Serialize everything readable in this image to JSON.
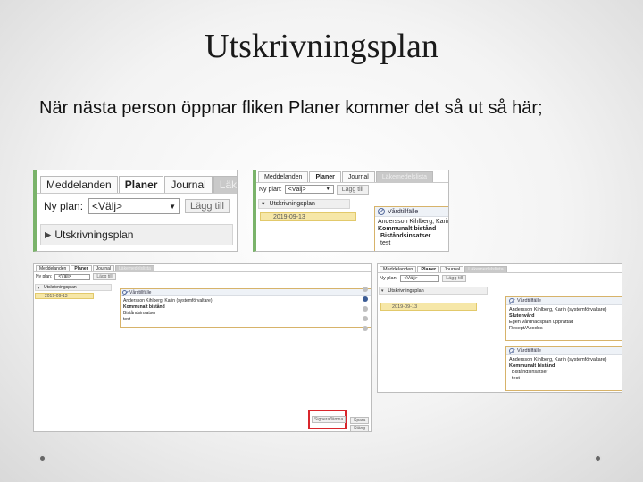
{
  "slide": {
    "title": "Utskrivningsplan",
    "body": "När nästa person öppnar fliken Planer kommer det så ut så här;"
  },
  "tabs": {
    "meddelanden": "Meddelanden",
    "planer": "Planer",
    "journal": "Journal",
    "lakemedel": "Läkem",
    "lakemedel_short": "Läkemedelslista"
  },
  "toolbar": {
    "ny_plan_label": "Ny plan:",
    "select_value": "<Välj>",
    "add_button": "Lägg till"
  },
  "plan": {
    "name": "Utskrivningsplan",
    "date": "2019-09-13"
  },
  "card": {
    "title": "Vårdtillfälle",
    "author": "Andersson Kihlberg, Karin (systemförvaltare)",
    "author_short": "Andersson Kihlberg, Karin (syste",
    "item1": "Kommunalt bistånd",
    "item2": "Biståndsinsatser",
    "item3": "test",
    "item4": "Slutenvård",
    "item5": "Egen vårdnadsplan upprättad",
    "item6": "Recept/Apodos"
  },
  "shot3": {
    "highlight_button": "Signera/lämna",
    "save_button": "Spara",
    "close_button": "Stäng"
  },
  "colors": {
    "highlight": "#d9262c",
    "selected_row": "#f6e7a8",
    "accent": "#3b5c95"
  }
}
